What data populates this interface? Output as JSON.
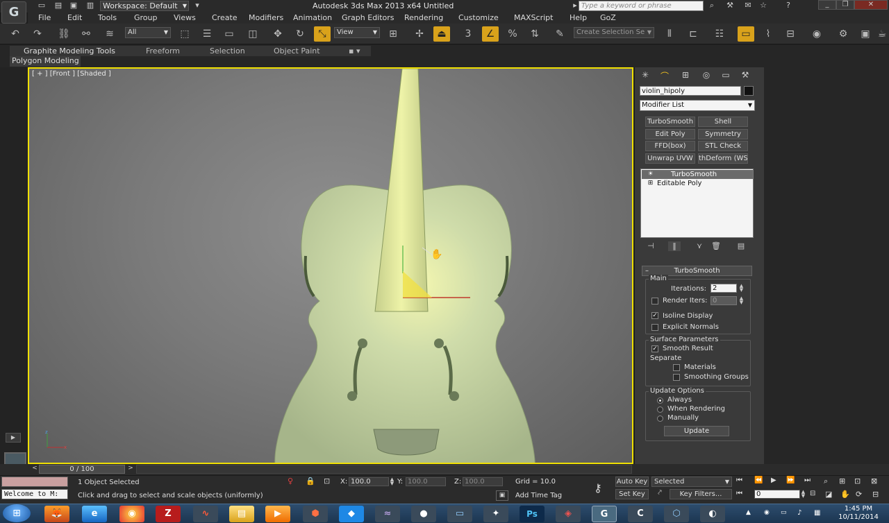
{
  "app": {
    "workspace": "Workspace: Default",
    "title": "Autodesk 3ds Max  2013 x64     Untitled",
    "search_placeholder": "Type a keyword or phrase"
  },
  "menu": [
    "File",
    "Edit",
    "Tools",
    "Group",
    "Views",
    "Create",
    "Modifiers",
    "Animation",
    "Graph Editors",
    "Rendering",
    "Customize",
    "MAXScript",
    "Help",
    "GoZ"
  ],
  "toolbar": {
    "selection_filter": "All",
    "ref_coord": "View",
    "named_selection_placeholder": "Create Selection Se"
  },
  "ribbon": {
    "tabs": [
      "Graphite Modeling Tools",
      "Freeform",
      "Selection",
      "Object Paint"
    ],
    "panel": "Polygon Modeling"
  },
  "viewport": {
    "label": "[ + ] [Front ] [Shaded ]"
  },
  "command_panel": {
    "object_name": "violin_hipoly",
    "modifier_list": "Modifier List",
    "modifier_buttons": [
      "TurboSmooth",
      "Shell",
      "Edit Poly",
      "Symmetry",
      "FFD(box)",
      "STL Check",
      "Unwrap UVW",
      "thDeform (WSI"
    ],
    "stack": [
      {
        "label": "TurboSmooth",
        "selected": true,
        "icon": "lightbulb-icon"
      },
      {
        "label": "Editable Poly",
        "selected": false,
        "icon": "plus-icon"
      }
    ],
    "turbosmooth": {
      "title": "TurboSmooth",
      "main_label": "Main",
      "iterations_label": "Iterations:",
      "iterations": "2",
      "render_iters_label": "Render Iters:",
      "render_iters": "0",
      "isoline_label": "Isoline Display",
      "explicit_normals_label": "Explicit Normals",
      "surface_params_label": "Surface Parameters",
      "smooth_result_label": "Smooth Result",
      "separate_label": "Separate",
      "materials_label": "Materials",
      "smoothing_groups_label": "Smoothing Groups",
      "update_options_label": "Update Options",
      "always_label": "Always",
      "when_rendering_label": "When Rendering",
      "manually_label": "Manually",
      "update_button": "Update"
    }
  },
  "timeline": {
    "frame": "0 / 100"
  },
  "status": {
    "maxscript_listener": "Welcome to M:",
    "selection_count": "1 Object Selected",
    "prompt": "Click and drag to select and scale objects (uniformly)",
    "x_label": "X:",
    "x_value": "100.0",
    "y_label": "Y:",
    "y_value": "100.0",
    "z_label": "Z:",
    "z_value": "100.0",
    "grid": "Grid = 10.0",
    "add_time_tag": "Add Time Tag",
    "auto_key": "Auto Key",
    "set_key": "Set Key",
    "key_mode": "Selected",
    "key_filters": "Key Filters...",
    "current_frame": "0"
  },
  "taskbar": {
    "time": "1:45 PM",
    "date": "10/11/2014",
    "apps": [
      "firefox",
      "internet-explorer",
      "chrome",
      "filezilla",
      "app",
      "explorer",
      "media-player",
      "app",
      "dropbox",
      "app",
      "app",
      "app",
      "app",
      "photoshop",
      "app",
      "3dsmax",
      "app",
      "app",
      "app"
    ]
  },
  "colors": {
    "active_viewport_border": "#f0e000",
    "active_tool": "#d9a21b",
    "violin_body": "#c9d6a4"
  }
}
